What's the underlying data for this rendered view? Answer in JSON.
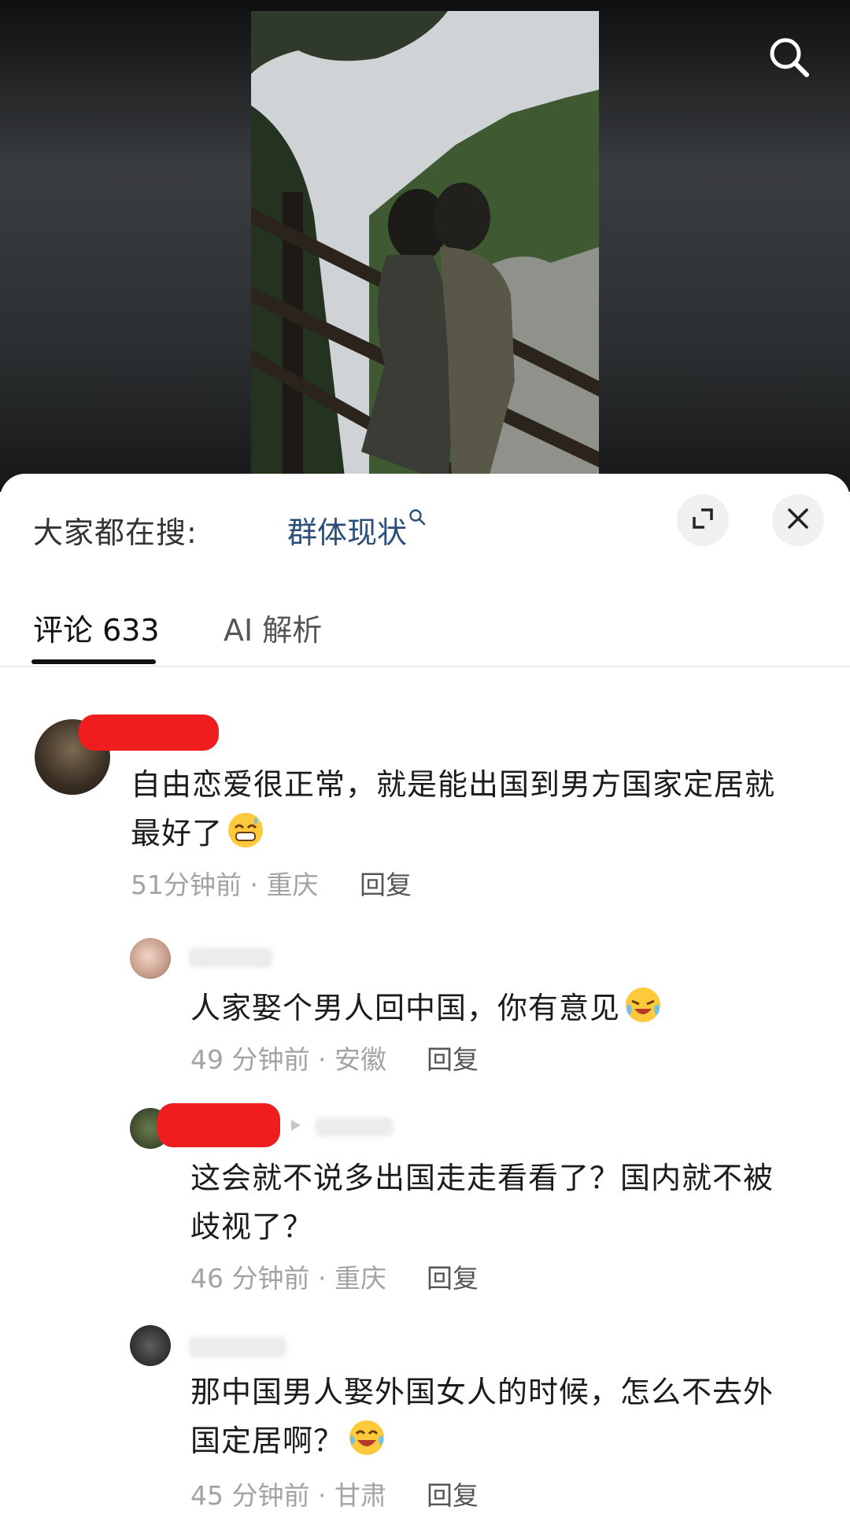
{
  "search_icon": "search-icon",
  "hot_search": {
    "prefix": "大家都在搜:",
    "term": "群体现状",
    "term_icon": "magnifier-icon"
  },
  "tabs": [
    {
      "label": "评论 633",
      "active": true
    },
    {
      "label": "AI 解析",
      "active": false
    }
  ],
  "comments": [
    {
      "text_line1": "自由恋爱很正常，就是能出国到男方国家定居就",
      "text_line2": "最好了",
      "emoji": "grinning-sweat-emoji",
      "meta": "51分钟前 · 重庆",
      "reply": "回复"
    },
    {
      "text_line1": "人家娶个男人回中国，你有意见",
      "emoji": "crying-laughing-emoji",
      "meta": "49 分钟前 · 安徽",
      "reply": "回复"
    },
    {
      "text_line1": "这会就不说多出国走走看看了？国内就不被",
      "text_line2": "歧视了？",
      "meta": "46 分钟前 · 重庆",
      "reply": "回复"
    },
    {
      "text_line1": "那中国男人娶外国女人的时候，怎么不去外",
      "text_line2": "国定居啊？",
      "emoji": "laughing-tears-emoji",
      "meta": "45 分钟前 · 甘肃",
      "reply": "回复"
    }
  ],
  "colors": {
    "hot_term": "#2b4f7a",
    "redaction": "#ef1d1d",
    "meta_text": "#a3a3a3"
  }
}
